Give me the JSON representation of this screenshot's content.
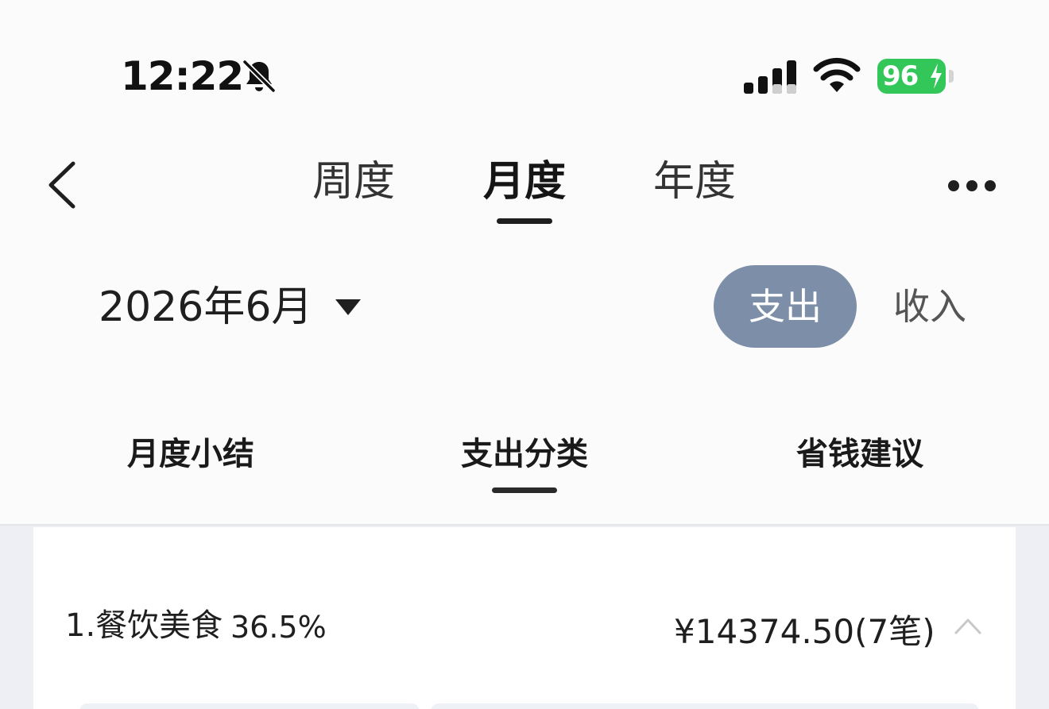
{
  "status_bar": {
    "time": "12:22",
    "battery_level": "96",
    "icons": [
      "bell-slash-icon",
      "signal-icon",
      "wifi-icon",
      "battery-charging-icon"
    ]
  },
  "nav": {
    "back_icon": "chevron-left-icon",
    "tabs": [
      {
        "label": "周度",
        "active": false
      },
      {
        "label": "月度",
        "active": true
      },
      {
        "label": "年度",
        "active": false
      }
    ],
    "more_icon": "more-horizontal-icon"
  },
  "period": {
    "label": "2026年6月",
    "caret_icon": "caret-down-icon"
  },
  "segment": {
    "expense_label": "支出",
    "income_label": "收入",
    "selected": "支出",
    "selected_color": "#7d8fa8"
  },
  "sub_tabs": [
    {
      "label": "月度小结",
      "active": false
    },
    {
      "label": "支出分类",
      "active": true
    },
    {
      "label": "省钱建议",
      "active": false
    }
  ],
  "categories": [
    {
      "name": "1.餐饮美食",
      "percent": "36.5%",
      "amount": "¥14374.50(7笔)",
      "expanded": true
    }
  ],
  "colors": {
    "battery": "#33c759",
    "accent": "#7d8fa8",
    "content_bg": "#edeff4"
  }
}
